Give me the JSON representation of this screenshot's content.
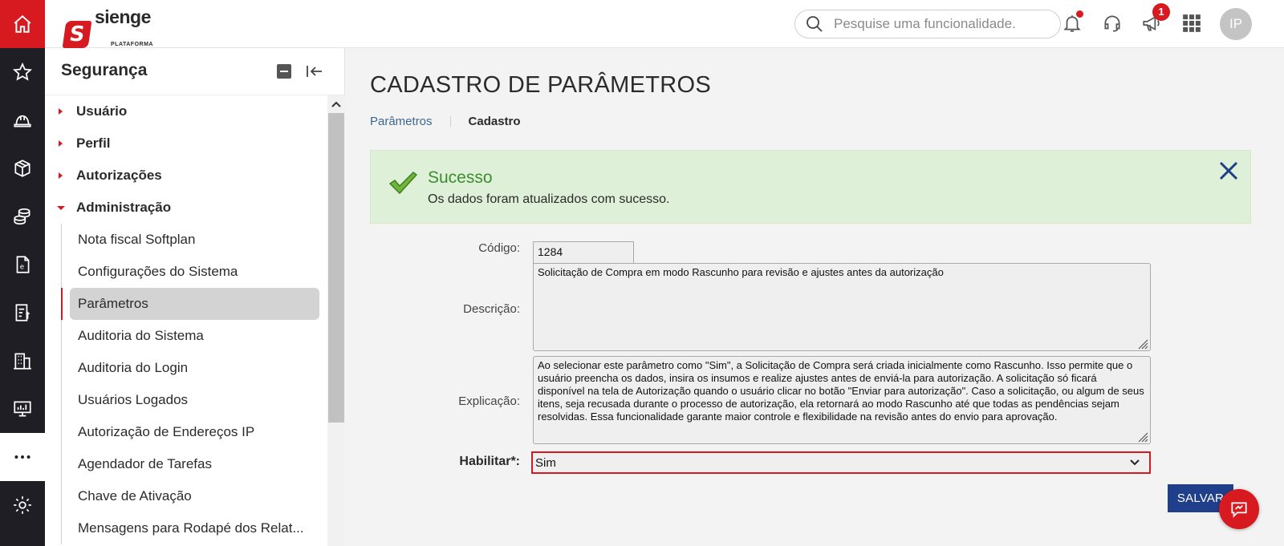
{
  "rail": {
    "icons": [
      "home-icon",
      "star-icon",
      "helmet-icon",
      "box-icon",
      "coins-icon",
      "document-icon",
      "invoice-icon",
      "building-icon",
      "monitor-icon",
      "more-icon",
      "gear-icon"
    ]
  },
  "header": {
    "logo_brand": "sienge",
    "logo_sub": "PLATAFORMA",
    "logo_mark": "S",
    "search_placeholder": "Pesquise uma funcionalidade.",
    "announcement_badge": "1",
    "avatar_initials": "IP"
  },
  "menu": {
    "title": "Segurança",
    "groups": [
      {
        "label": "Usuário",
        "expanded": false
      },
      {
        "label": "Perfil",
        "expanded": false
      },
      {
        "label": "Autorizações",
        "expanded": false
      },
      {
        "label": "Administração",
        "expanded": true
      }
    ],
    "sub_items": [
      {
        "label": "Nota fiscal Softplan"
      },
      {
        "label": "Configurações do Sistema"
      },
      {
        "label": "Parâmetros",
        "active": true
      },
      {
        "label": "Auditoria do Sistema"
      },
      {
        "label": "Auditoria do Login"
      },
      {
        "label": "Usuários Logados"
      },
      {
        "label": "Autorização de Endereços IP"
      },
      {
        "label": "Agendador de Tarefas"
      },
      {
        "label": "Chave de Ativação"
      },
      {
        "label": "Mensagens para Rodapé dos Relat..."
      }
    ]
  },
  "page": {
    "title": "CADASTRO DE PARÂMETROS",
    "breadcrumb": [
      "Parâmetros",
      "Cadastro"
    ]
  },
  "alert": {
    "title": "Sucesso",
    "message": "Os dados foram atualizados com sucesso.",
    "color": "#dff0d8"
  },
  "form": {
    "codigo_label": "Código:",
    "codigo_value": "1284",
    "descricao_label": "Descrição:",
    "descricao_value": "Solicitação de Compra em modo Rascunho para revisão e ajustes antes da autorização",
    "explicacao_label": "Explicação:",
    "explicacao_value": "Ao selecionar este parâmetro como \"Sim\", a Solicitação de Compra será criada inicialmente como Rascunho. Isso permite que o usuário preencha os dados, insira os insumos e realize ajustes antes de enviá-la para autorização. A solicitação só ficará disponível na tela de Autorização quando o usuário clicar no botão \"Enviar para autorização\". Caso a solicitação, ou algum de seus itens, seja recusada durante o processo de autorização, ela retornará ao modo Rascunho até que todas as pendências sejam resolvidas. Essa funcionalidade garante maior controle e flexibilidade na revisão antes do envio para aprovação.",
    "habilitar_label": "Habilitar*:",
    "habilitar_value": "Sim",
    "save_label": "SALVAR"
  },
  "colors": {
    "brand_red": "#d71920",
    "rail_dark": "#1e1e24",
    "save_blue": "#1f3f8a",
    "success_green": "#3c8d2f"
  }
}
